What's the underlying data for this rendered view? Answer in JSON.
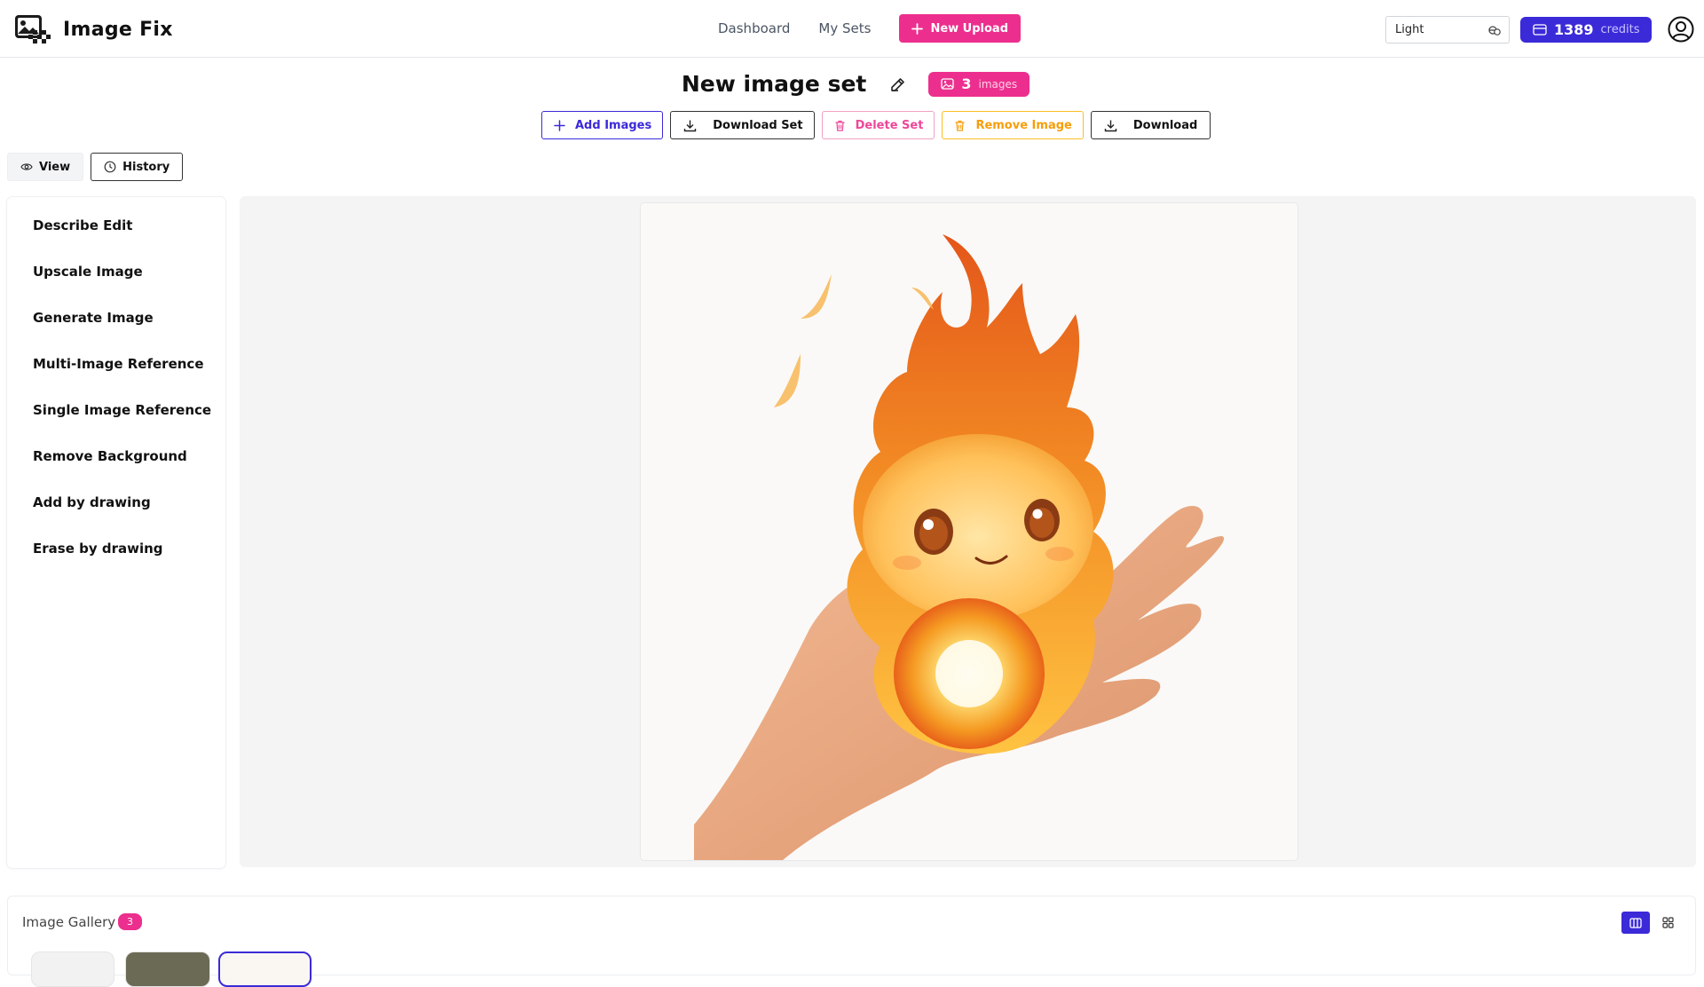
{
  "app": {
    "name": "Image Fix"
  },
  "nav": {
    "dashboard": "Dashboard",
    "my_sets": "My Sets",
    "new_upload": "New Upload"
  },
  "theme": {
    "selected": "Light"
  },
  "credits": {
    "value": "1389",
    "label": "credits"
  },
  "set": {
    "title": "New image set",
    "count": "3",
    "count_label": "images"
  },
  "actions": {
    "add_images": "Add Images",
    "download_set": "Download Set",
    "delete_set": "Delete Set",
    "remove_image": "Remove Image",
    "download": "Download"
  },
  "view_tabs": {
    "view": "View",
    "history": "History"
  },
  "tools": [
    "Describe Edit",
    "Upscale Image",
    "Generate Image",
    "Multi-Image Reference",
    "Single Image Reference",
    "Remove Background",
    "Add by drawing",
    "Erase by drawing"
  ],
  "gallery": {
    "title": "Image Gallery",
    "count": "3"
  },
  "colors": {
    "accent_pink": "#ec2f8e",
    "accent_indigo": "#3b2ad8",
    "warning": "#f59e0b",
    "danger": "#ec4899"
  }
}
